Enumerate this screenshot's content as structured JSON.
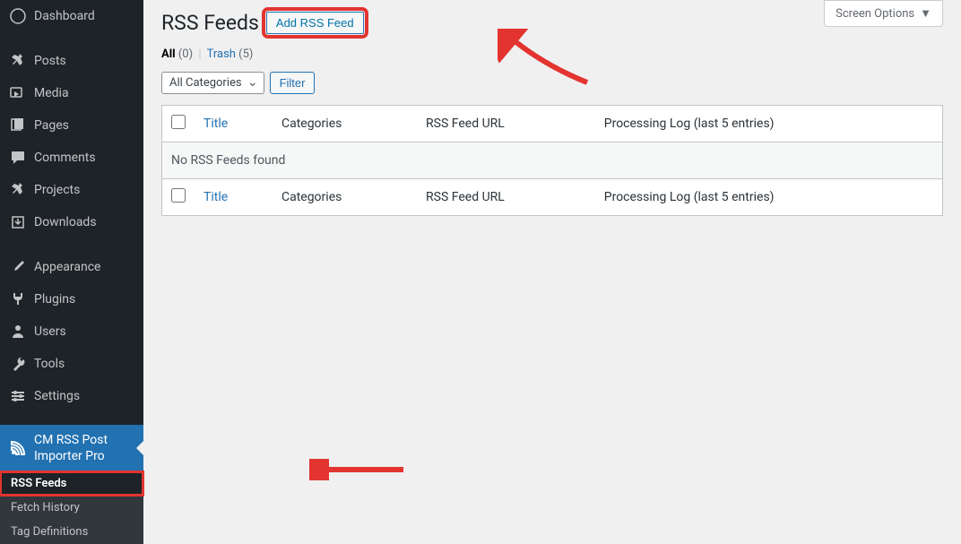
{
  "sidebar": {
    "items": [
      {
        "label": "Dashboard",
        "icon": "dashboard"
      },
      {
        "label": "Posts",
        "icon": "pin"
      },
      {
        "label": "Media",
        "icon": "media"
      },
      {
        "label": "Pages",
        "icon": "page"
      },
      {
        "label": "Comments",
        "icon": "comment"
      },
      {
        "label": "Projects",
        "icon": "pin"
      },
      {
        "label": "Downloads",
        "icon": "download"
      },
      {
        "label": "Appearance",
        "icon": "brush"
      },
      {
        "label": "Plugins",
        "icon": "plug"
      },
      {
        "label": "Users",
        "icon": "user"
      },
      {
        "label": "Tools",
        "icon": "wrench"
      },
      {
        "label": "Settings",
        "icon": "gear"
      },
      {
        "label": "CM RSS Post Importer Pro",
        "icon": "rss"
      }
    ],
    "sub_items": [
      {
        "label": "RSS Feeds"
      },
      {
        "label": "Fetch History"
      },
      {
        "label": "Tag Definitions"
      }
    ]
  },
  "header": {
    "screen_options": "Screen Options",
    "page_title": "RSS Feeds",
    "add_button": "Add RSS Feed"
  },
  "filters": {
    "all_label": "All",
    "all_count": "(0)",
    "trash_label": "Trash",
    "trash_count": "(5)",
    "category_select": "All Categories",
    "filter_button": "Filter"
  },
  "table": {
    "columns": [
      "Title",
      "Categories",
      "RSS Feed URL",
      "Processing Log (last 5 entries)"
    ],
    "empty": "No RSS Feeds found"
  }
}
